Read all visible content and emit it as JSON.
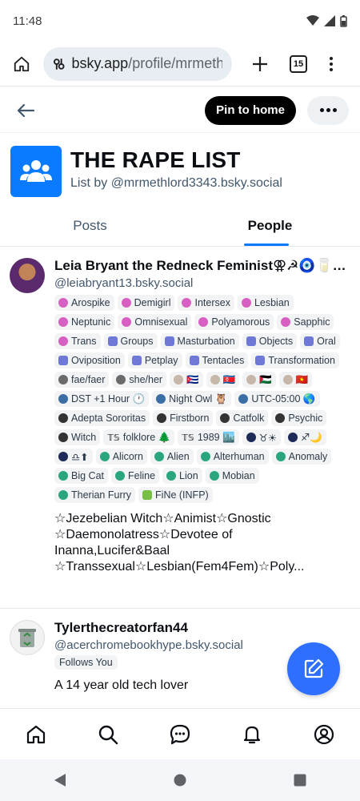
{
  "status_bar": {
    "time": "11:48"
  },
  "browser": {
    "url_host": "bsky.app",
    "url_path": "/profile/mrmethl",
    "tab_count": "15"
  },
  "header": {
    "pin_label": "Pin to home"
  },
  "list": {
    "title": "THE RAPE LIST",
    "by": "List by @mrmethlord3343.bsky.social"
  },
  "tabs": [
    {
      "label": "Posts"
    },
    {
      "label": "People"
    }
  ],
  "people": [
    {
      "name": "Leia Bryant the Redneck Feminist⚢☭🧿🥛…",
      "handle": "@leiabryant13.bsky.social",
      "labels": [
        {
          "icon": "pink",
          "text": "Arospike"
        },
        {
          "icon": "pink",
          "text": "Demigirl"
        },
        {
          "icon": "pink",
          "text": "Intersex"
        },
        {
          "icon": "pink",
          "text": "Lesbian"
        },
        {
          "icon": "pink",
          "text": "Neptunic"
        },
        {
          "icon": "pink",
          "text": "Omnisexual"
        },
        {
          "icon": "pink",
          "text": "Polyamorous"
        },
        {
          "icon": "pink",
          "text": "Sapphic"
        },
        {
          "icon": "pink",
          "text": "Trans"
        },
        {
          "icon": "blue",
          "text": "Groups"
        },
        {
          "icon": "blue",
          "text": "Masturbation"
        },
        {
          "icon": "blue",
          "text": "Objects"
        },
        {
          "icon": "blue",
          "text": "Oral"
        },
        {
          "icon": "blue",
          "text": "Oviposition"
        },
        {
          "icon": "blue",
          "text": "Petplay"
        },
        {
          "icon": "blue",
          "text": "Tentacles"
        },
        {
          "icon": "blue",
          "text": "Transformation"
        },
        {
          "icon": "grey",
          "text": "fae/faer"
        },
        {
          "icon": "grey",
          "text": "she/her"
        },
        {
          "icon": "beige",
          "text": "🇨🇺"
        },
        {
          "icon": "beige",
          "text": "🇰🇵"
        },
        {
          "icon": "beige",
          "text": "🇵🇸"
        },
        {
          "icon": "beige",
          "text": "🇻🇳"
        },
        {
          "icon": "earth",
          "text": "DST +1 Hour 🕐"
        },
        {
          "icon": "earth",
          "text": "Night Owl 🦉"
        },
        {
          "icon": "earth",
          "text": "UTC-05:00 🌎"
        },
        {
          "icon": "dark",
          "text": "Adepta Sororitas"
        },
        {
          "icon": "dark",
          "text": "Firstborn"
        },
        {
          "icon": "dark",
          "text": "Catfolk"
        },
        {
          "icon": "dark",
          "text": "Psychic"
        },
        {
          "icon": "dark",
          "text": "Witch"
        },
        {
          "icon": "ts",
          "text": "folklore 🌲"
        },
        {
          "icon": "ts",
          "text": "1989 🏙️"
        },
        {
          "icon": "space",
          "text": "♉☀"
        },
        {
          "icon": "space",
          "text": "♐🌙"
        },
        {
          "icon": "space",
          "text": "♎⬆"
        },
        {
          "icon": "teal",
          "text": "Alicorn"
        },
        {
          "icon": "teal",
          "text": "Alien"
        },
        {
          "icon": "teal",
          "text": "Alterhuman"
        },
        {
          "icon": "teal",
          "text": "Anomaly"
        },
        {
          "icon": "teal",
          "text": "Big Cat"
        },
        {
          "icon": "teal",
          "text": "Feline"
        },
        {
          "icon": "teal",
          "text": "Lion"
        },
        {
          "icon": "teal",
          "text": "Mobian"
        },
        {
          "icon": "teal",
          "text": "Therian Furry"
        },
        {
          "icon": "green",
          "text": "FiNe (INFP)"
        }
      ],
      "bio": "☆Jezebelian Witch☆Animist☆Gnostic ☆Daemonolatress☆Devotee of Inanna,Lucifer&Baal ☆Transsexual☆Lesbian(Fem4Fem)☆Poly..."
    },
    {
      "name": "Tylerthecreatorfan44",
      "handle": "@acerchromebookhype.bsky.social",
      "badge": "Follows You",
      "bio": "A 14 year old tech lover"
    }
  ],
  "colors": {
    "accent": "#0a7aff",
    "fab": "#2f6fff",
    "pin_button": "#000000"
  }
}
